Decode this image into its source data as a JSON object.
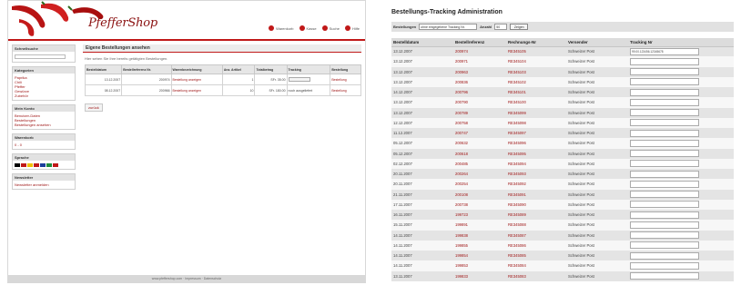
{
  "left": {
    "logo": "PfefferShop",
    "topnav": [
      "Warenkorb",
      "Kasse",
      "Suche",
      "Hilfe"
    ],
    "page_title": "Eigene Bestellungen ansehen",
    "intro": "Hier sehen Sie Ihre bereits getätigten Bestellungen.",
    "sidebar": [
      {
        "title": "Schnellsuche",
        "items": []
      },
      {
        "title": "Kategorien",
        "items": [
          "Paprika",
          "Chili",
          "Pfeffer",
          "Gewürze",
          "Zubehör"
        ]
      },
      {
        "title": "Mein Konto",
        "items": [
          "Benutzer-Daten",
          "Bestellungen",
          "Bestellungen ansehen"
        ]
      },
      {
        "title": "Warenkorb",
        "items": [
          "0 - 0"
        ]
      },
      {
        "title": "Sprache",
        "items": []
      },
      {
        "title": "Newsletter",
        "items": [
          "Newsletter anmelden"
        ]
      }
    ],
    "flag_colors": [
      "#000000",
      "#c01818",
      "#f0c000",
      "#c01818",
      "#1a3c9a",
      "#1d8a3a",
      "#c01818"
    ],
    "table": {
      "headers": [
        "Bestelldatum",
        "Bestellreferenz Nr.",
        "Warenbezeichnung",
        "Anz. Artikel",
        "Totalbetrag",
        "Tracking",
        "Bestellung"
      ],
      "rows": [
        [
          "13.12.2007",
          "200974",
          "Bestellung anzeigen",
          "1",
          "SFr. 35.00",
          "",
          "Bestellung"
        ],
        [
          "08.12.2007",
          "200966",
          "Bestellung anzeigen",
          "10",
          "SFr. 180.00",
          "noch ausgeliefert",
          "Bestellung"
        ]
      ]
    },
    "back_label": "zurück",
    "footer": "www.pfeffershop.com · Impressum · Datenschutz"
  },
  "right": {
    "title": "Bestellungs-Tracking Administration",
    "filter": {
      "label": "Bestellungen",
      "select_value": "ohne eingegebene Tracking Nr.",
      "count_label": "Anzahl",
      "count_value": "50",
      "button": "Zeigen"
    },
    "headers": [
      "Bestelldatum",
      "Bestellreferenz",
      "Rechnungs-Nr",
      "Versender",
      "Tracking Nr"
    ],
    "rows": [
      [
        "13.12.2007",
        "200974",
        "RE345105",
        "Schweizer Post",
        "99.00.123456.12345678"
      ],
      [
        "13.12.2007",
        "200971",
        "RE345104",
        "Schweizer Post",
        ""
      ],
      [
        "13.12.2007",
        "200963",
        "RE345103",
        "Schweizer Post",
        ""
      ],
      [
        "13.12.2007",
        "200836",
        "RE345102",
        "Schweizer Post",
        ""
      ],
      [
        "14.12.2007",
        "200796",
        "RE345101",
        "Schweizer Post",
        ""
      ],
      [
        "13.12.2007",
        "200790",
        "RE345100",
        "Schweizer Post",
        ""
      ],
      [
        "13.12.2007",
        "200789",
        "RE345099",
        "Schweizer Post",
        ""
      ],
      [
        "12.12.2007",
        "200758",
        "RE345098",
        "Schweizer Post",
        ""
      ],
      [
        "11.12.2007",
        "200747",
        "RE345097",
        "Schweizer Post",
        ""
      ],
      [
        "05.12.2007",
        "200632",
        "RE345096",
        "Schweizer Post",
        ""
      ],
      [
        "05.12.2007",
        "200618",
        "RE345095",
        "Schweizer Post",
        ""
      ],
      [
        "02.12.2007",
        "200485",
        "RE345094",
        "Schweizer Post",
        ""
      ],
      [
        "20.11.2007",
        "200264",
        "RE345093",
        "Schweizer Post",
        ""
      ],
      [
        "20.11.2007",
        "200254",
        "RE345092",
        "Schweizer Post",
        ""
      ],
      [
        "21.11.2007",
        "200108",
        "RE345091",
        "Schweizer Post",
        ""
      ],
      [
        "17.11.2007",
        "200738",
        "RE345090",
        "Schweizer Post",
        ""
      ],
      [
        "16.11.2007",
        "199723",
        "RE345089",
        "Schweizer Post",
        ""
      ],
      [
        "15.11.2007",
        "199891",
        "RE345088",
        "Schweizer Post",
        ""
      ],
      [
        "14.11.2007",
        "199838",
        "RE345087",
        "Schweizer Post",
        ""
      ],
      [
        "14.11.2007",
        "199855",
        "RE345086",
        "Schweizer Post",
        ""
      ],
      [
        "14.11.2007",
        "199854",
        "RE345085",
        "Schweizer Post",
        ""
      ],
      [
        "14.11.2007",
        "199853",
        "RE345084",
        "Schweizer Post",
        ""
      ],
      [
        "13.11.2007",
        "199833",
        "RE345083",
        "Schweizer Post",
        ""
      ]
    ]
  }
}
